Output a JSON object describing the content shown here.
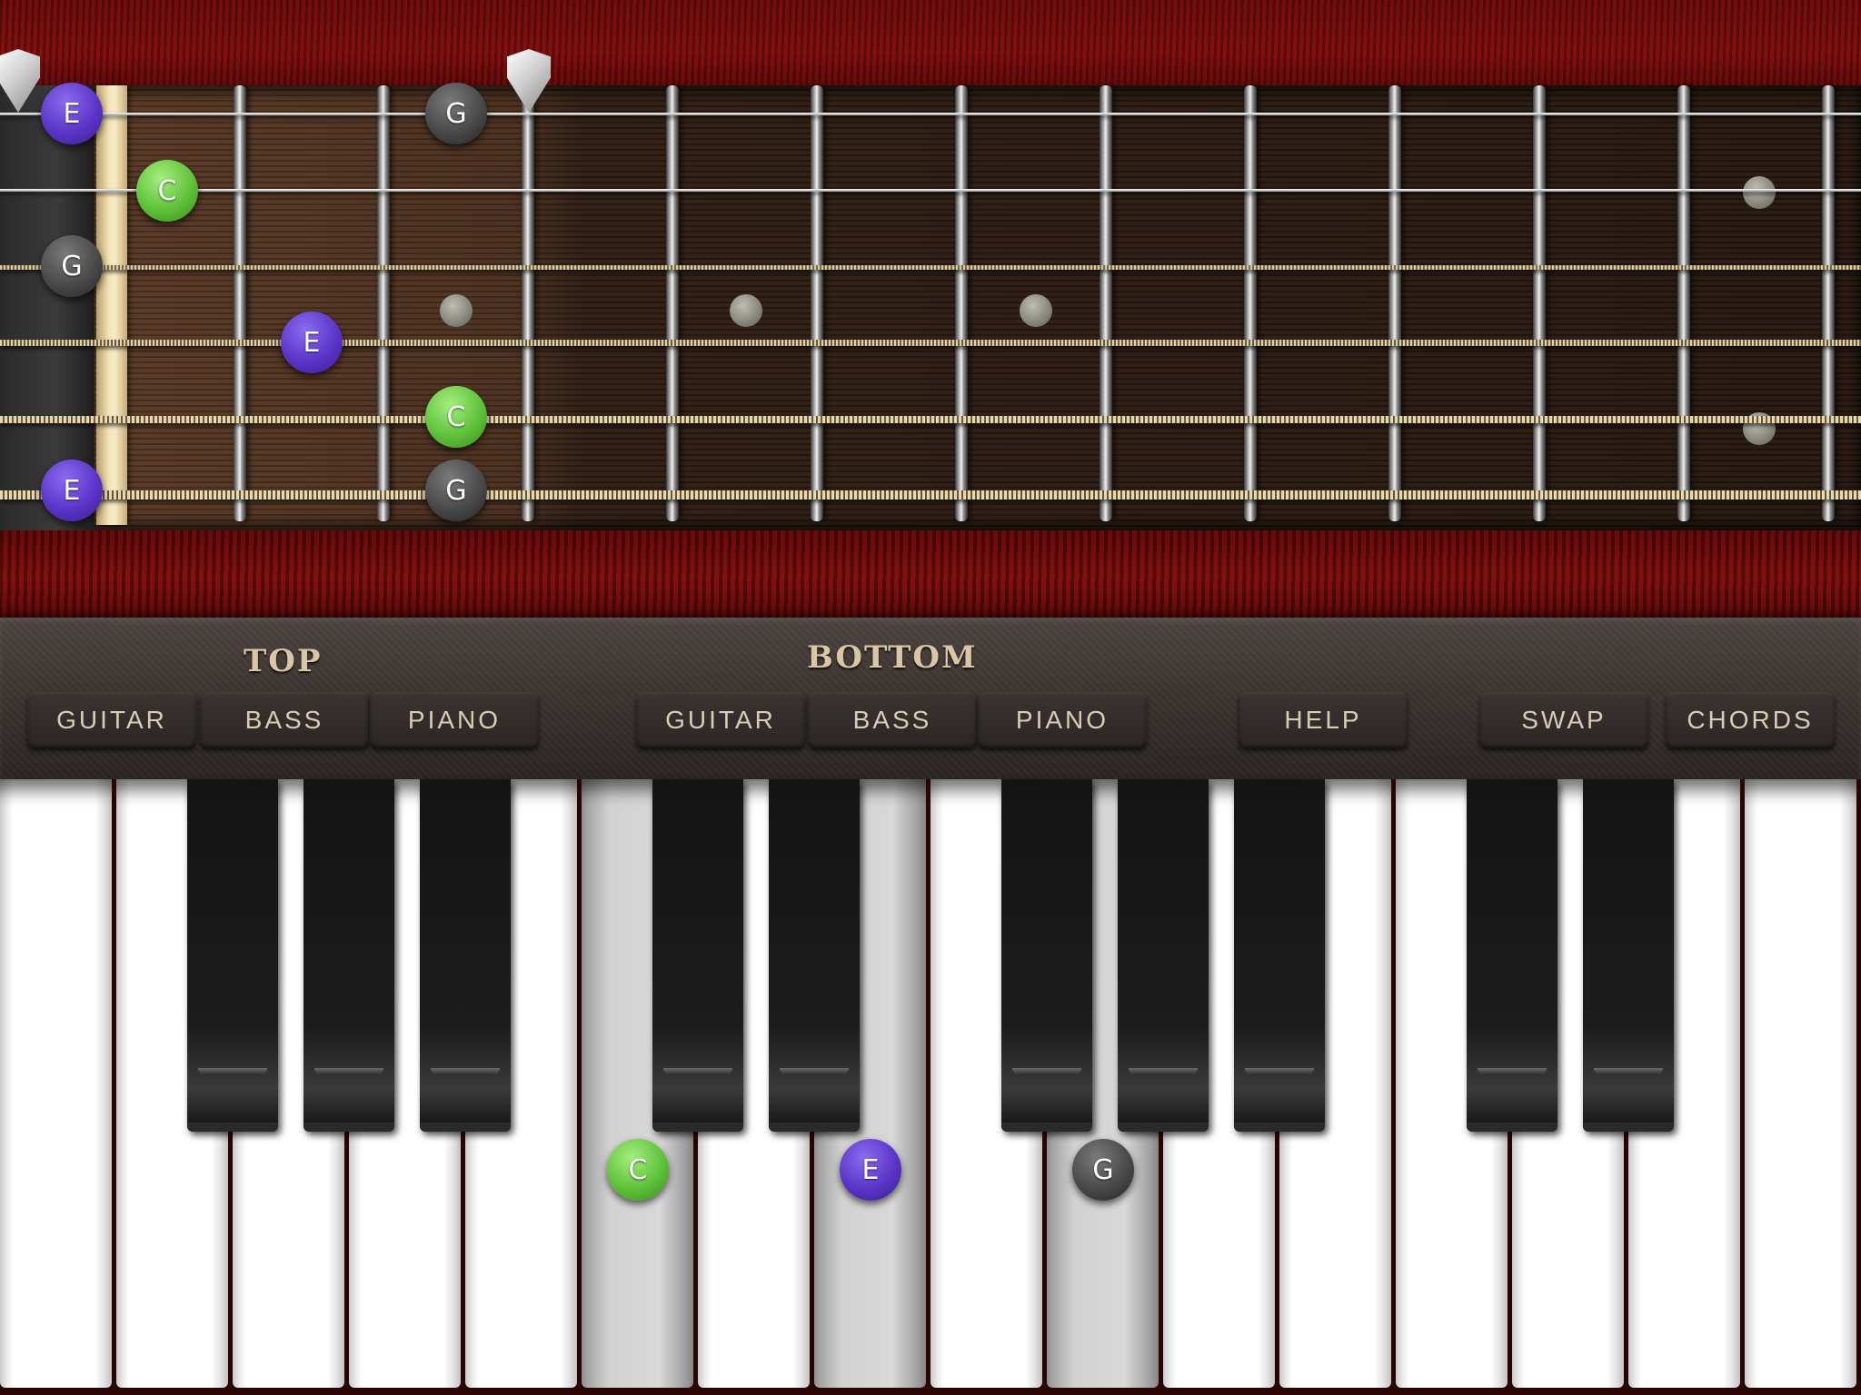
{
  "top_label": "TOP",
  "bottom_label": "BOTTOM",
  "top_buttons": [
    "GUITAR",
    "BASS",
    "PIANO"
  ],
  "bottom_buttons": [
    "GUITAR",
    "BASS",
    "PIANO"
  ],
  "help_label": "HELP",
  "swap_label": "SWAP",
  "chords_label": "CHORDS",
  "fretboard_notes": [
    {
      "string": 1,
      "fret": 0,
      "note": "E"
    },
    {
      "string": 1,
      "fret": 3,
      "note": "G"
    },
    {
      "string": 2,
      "fret": 1,
      "note": "C"
    },
    {
      "string": 3,
      "fret": 0,
      "note": "G"
    },
    {
      "string": 4,
      "fret": 2,
      "note": "E"
    },
    {
      "string": 5,
      "fret": 3,
      "note": "C"
    },
    {
      "string": 6,
      "fret": 0,
      "note": "E"
    },
    {
      "string": 6,
      "fret": 3,
      "note": "G"
    }
  ],
  "piano_notes": [
    "C",
    "E",
    "G"
  ],
  "colors": {
    "E": "#5b35c8",
    "C": "#5fc23a",
    "G": "#4a4a4a"
  }
}
